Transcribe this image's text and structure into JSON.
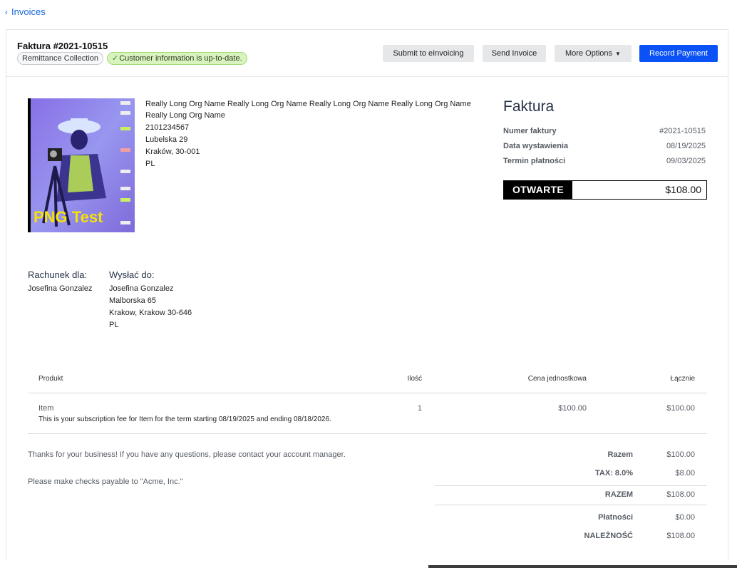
{
  "nav": {
    "back_label": "Invoices"
  },
  "header": {
    "invoice_title": "Faktura #2021-10515",
    "chips": {
      "remittance": "Remittance Collection",
      "customer_info": "Customer information is up-to-date."
    }
  },
  "actions": {
    "submit": "Submit to eInvoicing",
    "send": "Send Invoice",
    "more": "More Options",
    "record": "Record Payment"
  },
  "logo": {
    "caption": "PNG Test"
  },
  "seller": {
    "name_line1": "Really Long Org Name Really Long Org Name Really Long Org Name Really Long Org Name",
    "name_line2": "Really Long Org Name",
    "tax_id": "2101234567",
    "street": "Lubelska 29",
    "city": "Kraków, 30-001",
    "country": "PL"
  },
  "document": {
    "title": "Faktura",
    "meta": [
      {
        "label": "Numer faktury",
        "value": "#2021-10515"
      },
      {
        "label": "Data wystawienia",
        "value": "08/19/2025"
      },
      {
        "label": "Termin płatności",
        "value": "09/03/2025"
      }
    ],
    "status": "OTWARTE",
    "amount": "$108.00"
  },
  "bill_to": {
    "heading": "Rachunek dla:",
    "name": "Josefina Gonzalez"
  },
  "ship_to": {
    "heading": "Wysłać do:",
    "name": "Josefina Gonzalez",
    "street": "Malborska 65",
    "city": "Krakow, Krakow 30-646",
    "country": "PL"
  },
  "table": {
    "headers": {
      "product": "Produkt",
      "qty": "Ilość",
      "unit_price": "Cena jednostkowa",
      "total": "Łącznie"
    },
    "rows": [
      {
        "product": "Item",
        "description": "This is your subscription fee for Item for the term starting 08/19/2025 and ending 08/18/2026.",
        "qty": "1",
        "unit_price": "$100.00",
        "total": "$100.00"
      }
    ]
  },
  "notes": {
    "thanks": "Thanks for your business! If you have any questions, please contact your account manager.",
    "checks": "Please make checks payable to \"Acme, Inc.\""
  },
  "totals": [
    {
      "label": "Razem",
      "value": "$100.00"
    },
    {
      "label": "TAX: 8.0%",
      "value": "$8.00"
    },
    {
      "label": "RAZEM",
      "value": "$108.00"
    },
    {
      "label": "Płatności",
      "value": "$0.00"
    },
    {
      "label": "NALEŻNOŚĆ",
      "value": "$108.00"
    }
  ],
  "colors": {
    "accent": "#0a52f5",
    "link": "#1a66d6",
    "ok_chip": "#d9f3bf",
    "status_bg": "#000000"
  }
}
